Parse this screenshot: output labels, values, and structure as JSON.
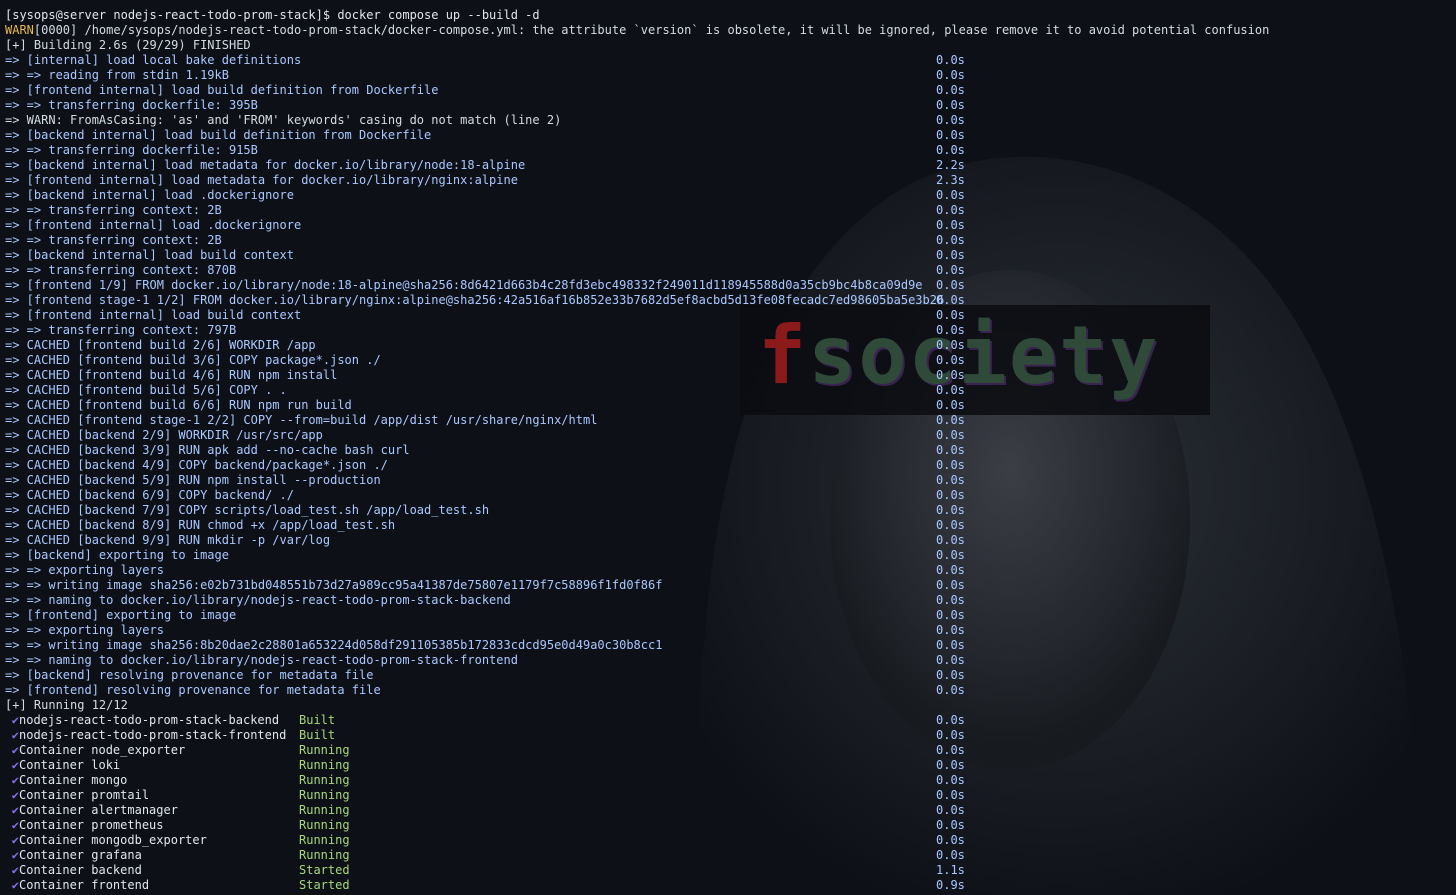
{
  "terminal": {
    "prompt_line": "[sysops@server nodejs-react-todo-prom-stack]$ docker compose up --build -d",
    "warn_tag": "WARN",
    "warn_text": "[0000] /home/sysops/nodejs-react-todo-prom-stack/docker-compose.yml: the attribute `version` is obsolete, it will be ignored, please remove it to avoid potential confusion",
    "building_header": "[+] Building 2.6s (29/29) FINISHED",
    "build_steps": [
      {
        "text": "=> [internal] load local bake definitions",
        "time": "0.0s"
      },
      {
        "text": "=> => reading from stdin 1.19kB",
        "time": "0.0s"
      },
      {
        "text": "=> [frontend internal] load build definition from Dockerfile",
        "time": "0.0s"
      },
      {
        "text": "=> => transferring dockerfile: 395B",
        "time": "0.0s"
      },
      {
        "text": "=> WARN: FromAsCasing: 'as' and 'FROM' keywords' casing do not match (line 2)",
        "time": "0.0s",
        "plain": true
      },
      {
        "text": "=> [backend internal] load build definition from Dockerfile",
        "time": "0.0s"
      },
      {
        "text": "=> => transferring dockerfile: 915B",
        "time": "0.0s"
      },
      {
        "text": "=> [backend internal] load metadata for docker.io/library/node:18-alpine",
        "time": "2.2s"
      },
      {
        "text": "=> [frontend internal] load metadata for docker.io/library/nginx:alpine",
        "time": "2.3s"
      },
      {
        "text": "=> [backend internal] load .dockerignore",
        "time": "0.0s"
      },
      {
        "text": "=> => transferring context: 2B",
        "time": "0.0s"
      },
      {
        "text": "=> [frontend internal] load .dockerignore",
        "time": "0.0s"
      },
      {
        "text": "=> => transferring context: 2B",
        "time": "0.0s"
      },
      {
        "text": "=> [backend internal] load build context",
        "time": "0.0s"
      },
      {
        "text": "=> => transferring context: 870B",
        "time": "0.0s"
      },
      {
        "text": "=> [frontend 1/9] FROM docker.io/library/node:18-alpine@sha256:8d6421d663b4c28fd3ebc498332f249011d118945588d0a35cb9bc4b8ca09d9e",
        "time": "0.0s"
      },
      {
        "text": "=> [frontend stage-1 1/2] FROM docker.io/library/nginx:alpine@sha256:42a516af16b852e33b7682d5ef8acbd5d13fe08fecadc7ed98605ba5e3b26",
        "time": "0.0s"
      },
      {
        "text": "=> [frontend internal] load build context",
        "time": "0.0s"
      },
      {
        "text": "=> => transferring context: 797B",
        "time": "0.0s"
      },
      {
        "text": "=> CACHED [frontend build 2/6] WORKDIR /app",
        "time": "0.0s"
      },
      {
        "text": "=> CACHED [frontend build 3/6] COPY package*.json ./",
        "time": "0.0s"
      },
      {
        "text": "=> CACHED [frontend build 4/6] RUN npm install",
        "time": "0.0s"
      },
      {
        "text": "=> CACHED [frontend build 5/6] COPY . .",
        "time": "0.0s"
      },
      {
        "text": "=> CACHED [frontend build 6/6] RUN npm run build",
        "time": "0.0s"
      },
      {
        "text": "=> CACHED [frontend stage-1 2/2] COPY --from=build /app/dist /usr/share/nginx/html",
        "time": "0.0s"
      },
      {
        "text": "=> CACHED [backend 2/9] WORKDIR /usr/src/app",
        "time": "0.0s"
      },
      {
        "text": "=> CACHED [backend 3/9] RUN apk add --no-cache bash curl",
        "time": "0.0s"
      },
      {
        "text": "=> CACHED [backend 4/9] COPY backend/package*.json ./",
        "time": "0.0s"
      },
      {
        "text": "=> CACHED [backend 5/9] RUN npm install --production",
        "time": "0.0s"
      },
      {
        "text": "=> CACHED [backend 6/9] COPY backend/ ./",
        "time": "0.0s"
      },
      {
        "text": "=> CACHED [backend 7/9] COPY scripts/load_test.sh /app/load_test.sh",
        "time": "0.0s"
      },
      {
        "text": "=> CACHED [backend 8/9] RUN chmod +x /app/load_test.sh",
        "time": "0.0s"
      },
      {
        "text": "=> CACHED [backend 9/9] RUN mkdir -p /var/log",
        "time": "0.0s"
      },
      {
        "text": "=> [backend] exporting to image",
        "time": "0.0s"
      },
      {
        "text": "=> => exporting layers",
        "time": "0.0s"
      },
      {
        "text": "=> => writing image sha256:e02b731bd048551b73d27a989cc95a41387de75807e1179f7c58896f1fd0f86f",
        "time": "0.0s"
      },
      {
        "text": "=> => naming to docker.io/library/nodejs-react-todo-prom-stack-backend",
        "time": "0.0s"
      },
      {
        "text": "=> [frontend] exporting to image",
        "time": "0.0s"
      },
      {
        "text": "=> => exporting layers",
        "time": "0.0s"
      },
      {
        "text": "=> => writing image sha256:8b20dae2c28801a653224d058df291105385b172833cdcd95e0d49a0c30b8cc1",
        "time": "0.0s"
      },
      {
        "text": "=> => naming to docker.io/library/nodejs-react-todo-prom-stack-frontend",
        "time": "0.0s"
      },
      {
        "text": "=> [backend] resolving provenance for metadata file",
        "time": "0.0s"
      },
      {
        "text": "=> [frontend] resolving provenance for metadata file",
        "time": "0.0s"
      }
    ],
    "running_header": "[+] Running 12/12",
    "check_glyph": "✔",
    "running_items": [
      {
        "name": "nodejs-react-todo-prom-stack-backend",
        "status": "Built",
        "time": "0.0s",
        "kind": "built"
      },
      {
        "name": "nodejs-react-todo-prom-stack-frontend",
        "status": "Built",
        "time": "0.0s",
        "kind": "built"
      },
      {
        "name": "Container node_exporter",
        "status": "Running",
        "time": "0.0s",
        "kind": "running"
      },
      {
        "name": "Container loki",
        "status": "Running",
        "time": "0.0s",
        "kind": "running"
      },
      {
        "name": "Container mongo",
        "status": "Running",
        "time": "0.0s",
        "kind": "running"
      },
      {
        "name": "Container promtail",
        "status": "Running",
        "time": "0.0s",
        "kind": "running"
      },
      {
        "name": "Container alertmanager",
        "status": "Running",
        "time": "0.0s",
        "kind": "running"
      },
      {
        "name": "Container prometheus",
        "status": "Running",
        "time": "0.0s",
        "kind": "running"
      },
      {
        "name": "Container mongodb_exporter",
        "status": "Running",
        "time": "0.0s",
        "kind": "running"
      },
      {
        "name": "Container grafana",
        "status": "Running",
        "time": "0.0s",
        "kind": "running"
      },
      {
        "name": "Container backend",
        "status": "Started",
        "time": "1.1s",
        "kind": "started"
      },
      {
        "name": "Container frontend",
        "status": "Started",
        "time": "0.9s",
        "kind": "started"
      }
    ]
  },
  "wallpaper": {
    "logo_first": "f",
    "logo_rest": "society",
    "logo_colors": {
      "first": "#8b1a1a",
      "rest": "#2f4a38"
    }
  }
}
